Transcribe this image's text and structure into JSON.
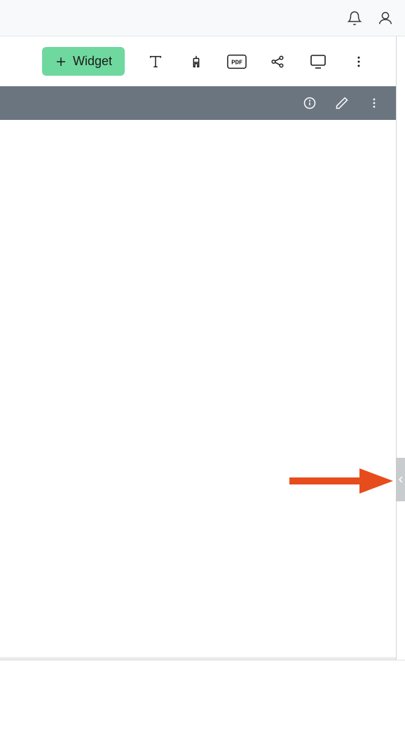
{
  "header": {
    "notifications_icon": "bell-icon",
    "profile_icon": "user-icon"
  },
  "toolbar": {
    "widget_button_label": "Widget",
    "text_tool": "text-icon",
    "brush_tool": "brush-icon",
    "pdf_tool": "PDF",
    "share_tool": "share-icon",
    "screen_tool": "screen-icon",
    "more_tool": "more-icon"
  },
  "panel": {
    "info_icon": "info-icon",
    "edit_icon": "pencil-icon",
    "more_icon": "more-icon"
  },
  "collapse": {
    "direction": "left"
  }
}
